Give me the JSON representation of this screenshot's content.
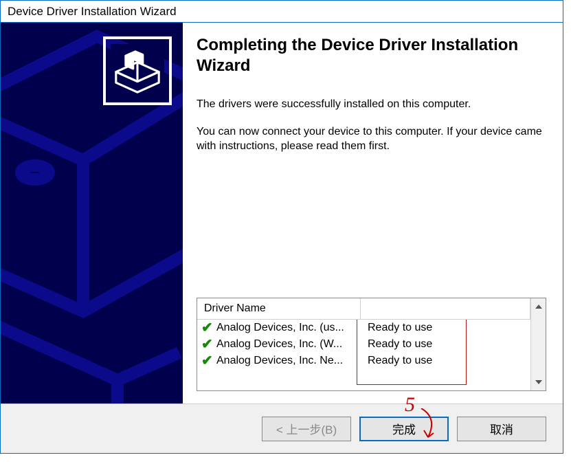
{
  "window": {
    "title": "Device Driver Installation Wizard"
  },
  "main": {
    "heading": "Completing the Device Driver Installation Wizard",
    "text1": "The drivers were successfully installed on this computer.",
    "text2": "You can now connect your device to this computer. If your device came with instructions, please read them first."
  },
  "driverList": {
    "header": "Driver Name",
    "rows": [
      {
        "icon": "✔",
        "name": "Analog Devices, Inc. (us...",
        "status": "Ready to use"
      },
      {
        "icon": "✔",
        "name": "Analog Devices, Inc. (W...",
        "status": "Ready to use"
      },
      {
        "icon": "✔",
        "name": "Analog Devices, Inc. Ne...",
        "status": "Ready to use"
      }
    ]
  },
  "buttons": {
    "back": "< 上一步(B)",
    "finish": "完成",
    "cancel": "取消"
  },
  "annotation": {
    "label": "5"
  }
}
